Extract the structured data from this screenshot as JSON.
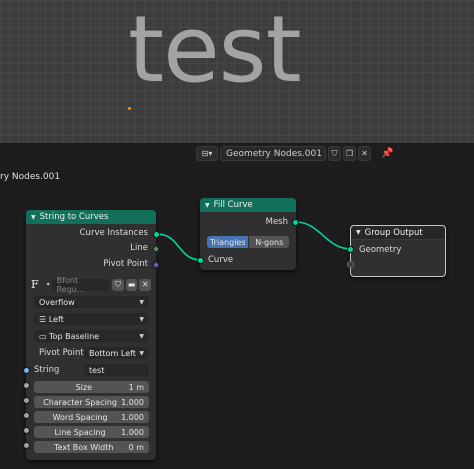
{
  "viewport": {
    "text": "test"
  },
  "header": {
    "editor_type_icon": "node-editor-icon",
    "tree_name": "Geometry Nodes.001",
    "tree_label_partial": "ry Nodes.001"
  },
  "nodes": {
    "string_to_curves": {
      "title": "String to Curves",
      "outputs": [
        "Curve Instances",
        "Line",
        "Pivot Point"
      ],
      "font_name": "Bfont Regu...",
      "overflow": "Overflow",
      "align_x": "Left",
      "align_y": "Top Baseline",
      "pivot_label": "Pivot Point",
      "pivot_value": "Bottom Left",
      "string_label": "String",
      "string_value": "test",
      "inputs": [
        {
          "label": "Size",
          "value": "1 m"
        },
        {
          "label": "Character Spacing",
          "value": "1.000"
        },
        {
          "label": "Word Spacing",
          "value": "1.000"
        },
        {
          "label": "Line Spacing",
          "value": "1.000"
        },
        {
          "label": "Text Box Width",
          "value": "0 m"
        }
      ]
    },
    "fill_curve": {
      "title": "Fill Curve",
      "output": "Mesh",
      "mode_options": [
        "Triangles",
        "N-gons"
      ],
      "input": "Curve"
    },
    "group_output": {
      "title": "Group Output",
      "input": "Geometry"
    }
  },
  "colors": {
    "geometry_socket": "#00d6a3",
    "node_header_geometry": "#12705a",
    "active_option": "#4772b3"
  }
}
